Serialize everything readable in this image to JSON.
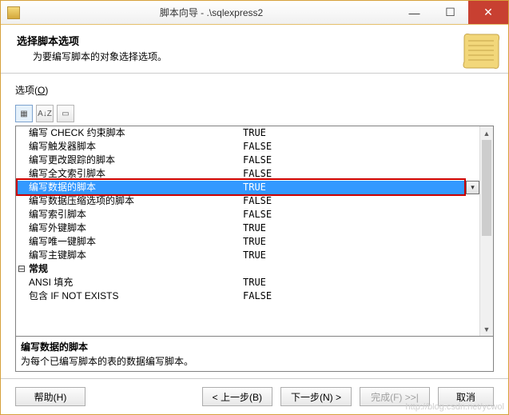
{
  "window": {
    "title": "脚本向导 - .\\sqlexpress2",
    "min": "—",
    "max": "☐",
    "close": "✕"
  },
  "header": {
    "title": "选择脚本选项",
    "subtitle": "为要编写脚本的对象选择选项。"
  },
  "options_label": "选项(",
  "options_key": "O",
  "options_label_end": ")",
  "toolbar": {
    "cat": "▦",
    "az": "A↓Z",
    "page": "▭"
  },
  "rows": [
    {
      "indent": "",
      "name": "编写 CHECK 约束脚本",
      "value": "TRUE",
      "sel": false,
      "cat": false
    },
    {
      "indent": "",
      "name": "编写触发器脚本",
      "value": "FALSE",
      "sel": false,
      "cat": false
    },
    {
      "indent": "",
      "name": "编写更改跟踪的脚本",
      "value": "FALSE",
      "sel": false,
      "cat": false
    },
    {
      "indent": "",
      "name": "编写全文索引脚本",
      "value": "FALSE",
      "sel": false,
      "cat": false
    },
    {
      "indent": "",
      "name": "编写数据的脚本",
      "value": "TRUE",
      "sel": true,
      "cat": false
    },
    {
      "indent": "",
      "name": "编写数据压缩选项的脚本",
      "value": "FALSE",
      "sel": false,
      "cat": false
    },
    {
      "indent": "",
      "name": "编写索引脚本",
      "value": "FALSE",
      "sel": false,
      "cat": false
    },
    {
      "indent": "",
      "name": "编写外键脚本",
      "value": "TRUE",
      "sel": false,
      "cat": false
    },
    {
      "indent": "",
      "name": "编写唯一键脚本",
      "value": "TRUE",
      "sel": false,
      "cat": false
    },
    {
      "indent": "",
      "name": "编写主键脚本",
      "value": "TRUE",
      "sel": false,
      "cat": false
    },
    {
      "indent": "⊟",
      "name": "常规",
      "value": "",
      "sel": false,
      "cat": true
    },
    {
      "indent": "",
      "name": "ANSI 填充",
      "value": "TRUE",
      "sel": false,
      "cat": false
    },
    {
      "indent": "",
      "name": "包含 IF NOT EXISTS",
      "value": "FALSE",
      "sel": false,
      "cat": false
    }
  ],
  "desc": {
    "title": "编写数据的脚本",
    "text": "为每个已编写脚本的表的数据编写脚本。"
  },
  "buttons": {
    "help": "帮助(H)",
    "back": "< 上一步(B)",
    "next": "下一步(N) >",
    "finish": "完成(F) >>|",
    "cancel": "取消"
  },
  "watermark": "http://blog.csdn.net/ycwol"
}
